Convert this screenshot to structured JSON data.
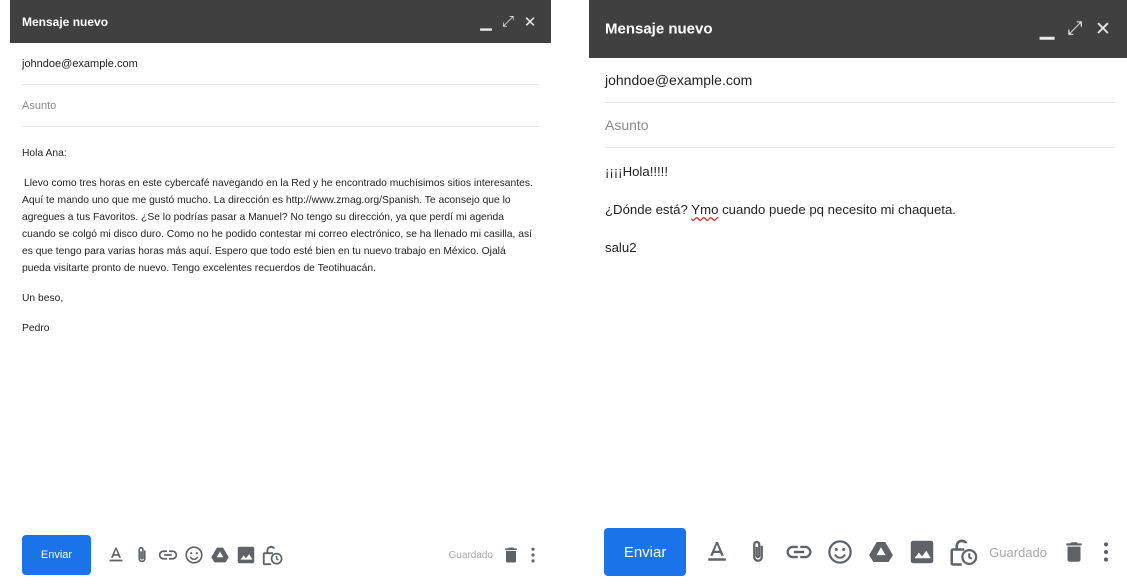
{
  "windows": [
    {
      "title": "Mensaje nuevo",
      "to": "johndoe@example.com",
      "subject_placeholder": "Asunto",
      "body": [
        "Hola Ana:",
        "Llevo como tres horas en este cybercafé navegando en la Red y he encontrado muchísimos sitios interesantes. Aquí te mando uno que me gustó mucho. La dirección es http://www.zmag.org/Spanish. Te aconsejo que lo agregues a tus Favoritos. ¿Se lo podrías pasar a Manuel? No tengo su dirección, ya que perdí mi agenda cuando se colgó mi disco duro. Como no he podido contestar mi correo electrónico, se ha llenado mi casilla, así es que tengo para varias horas más aquí. Espero que todo esté bien en tu nuevo trabajo en México. Ojalá pueda visitarte pronto de nuevo. Tengo excelentes recuerdos de Teotihuacán.",
        "Un beso,",
        "Pedro"
      ],
      "send_label": "Enviar",
      "saved_label": "Guardado"
    },
    {
      "title": "Mensaje nuevo",
      "to": "johndoe@example.com",
      "subject_placeholder": "Asunto",
      "body_line1": "¡¡¡¡Hola!!!!!",
      "body_line2_pre": "¿Dónde está? ",
      "body_line2_typo": "Ymo",
      "body_line2_post": " cuando puede pq necesito mi chaqueta.",
      "body_line3": "salu2",
      "send_label": "Enviar",
      "saved_label": "Guardado"
    }
  ],
  "icons": {
    "titlebar": [
      "minimize-icon",
      "expand-icon",
      "close-icon"
    ],
    "toolbar": [
      "text-format-icon",
      "attach-icon",
      "link-icon",
      "emoji-icon",
      "drive-icon",
      "image-icon",
      "confidential-icon"
    ],
    "right": [
      "trash-icon",
      "more-options-icon"
    ]
  },
  "colors": {
    "titlebar": "#404040",
    "send_button": "#1a73e8",
    "spell_error": "#d93025"
  }
}
